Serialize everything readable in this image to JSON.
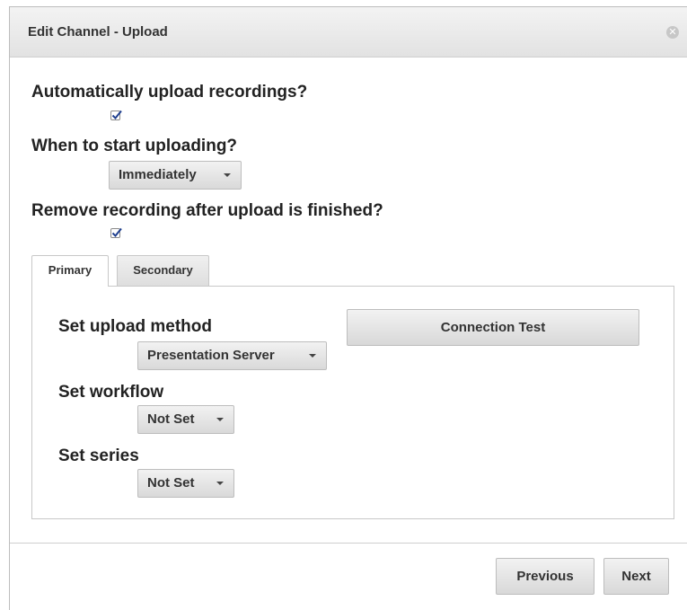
{
  "dialog": {
    "title": "Edit Channel - Upload",
    "close_glyph": "✕"
  },
  "auto_upload": {
    "label": "Automatically upload recordings?",
    "checked": true
  },
  "start_upload": {
    "label": "When to start uploading?",
    "selected": "Immediately"
  },
  "remove_after": {
    "label": "Remove recording after upload is finished?",
    "checked": true
  },
  "tabs": [
    {
      "label": "Primary",
      "active": true
    },
    {
      "label": "Secondary",
      "active": false
    }
  ],
  "primary": {
    "upload_method_label": "Set upload method",
    "upload_method_selected": "Presentation Server",
    "connection_test_label": "Connection Test",
    "workflow_label": "Set workflow",
    "workflow_selected": "Not Set",
    "series_label": "Set series",
    "series_selected": "Not Set"
  },
  "footer": {
    "previous_label": "Previous",
    "next_label": "Next"
  },
  "icons": {
    "close": "close-icon",
    "checkmark": "checkmark-icon",
    "caret": "chevron-down-icon"
  }
}
